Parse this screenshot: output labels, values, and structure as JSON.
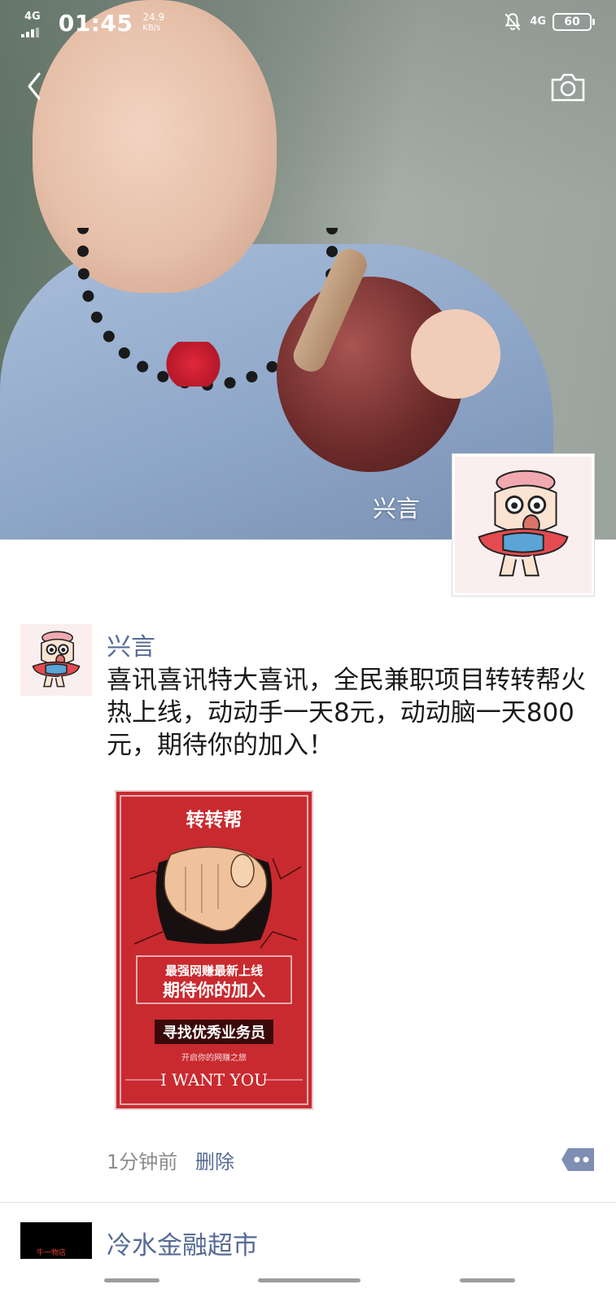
{
  "status_bar": {
    "network_left": "4G",
    "time": "01:45",
    "speed_value": "24.9",
    "speed_unit": "KB/s",
    "network_right": "4G",
    "battery": "60"
  },
  "cover": {
    "owner_name": "兴言"
  },
  "post": {
    "author": "兴言",
    "text": "喜讯喜讯特大喜讯，全民兼职项目转转帮火热上线，动动手一天8元，动动脑一天800元，期待你的加入！",
    "image": {
      "brand": "转转帮",
      "line1": "最强网赚最新上线",
      "line2": "期待你的加入",
      "line3": "寻找优秀业务员",
      "line4": "开启你的网赚之旅",
      "line5": "I WANT YOU"
    },
    "time": "1分钟前",
    "delete_label": "删除"
  },
  "next_post": {
    "author": "冷水金融超市",
    "avatar_text": "牛一物店"
  },
  "colors": {
    "link_blue": "#576b95",
    "poster_red": "#c92a2f",
    "text_dark": "#1a1a1a",
    "meta_gray": "#8c8c8c"
  },
  "icons": [
    "back-chevron-icon",
    "camera-icon",
    "bell-off-icon",
    "comment-dots-icon",
    "signal-icon",
    "battery-icon"
  ]
}
